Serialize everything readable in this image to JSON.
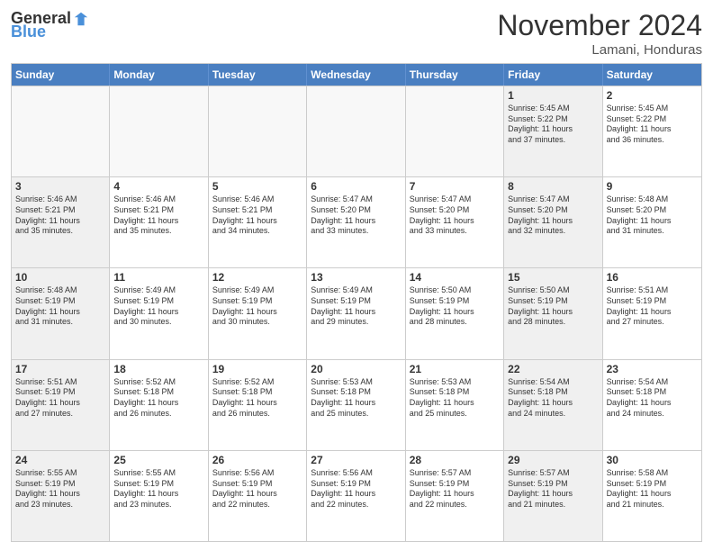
{
  "header": {
    "logo_general": "General",
    "logo_blue": "Blue",
    "month_title": "November 2024",
    "location": "Lamani, Honduras"
  },
  "weekdays": [
    "Sunday",
    "Monday",
    "Tuesday",
    "Wednesday",
    "Thursday",
    "Friday",
    "Saturday"
  ],
  "rows": [
    [
      {
        "num": "",
        "info": "",
        "empty": true
      },
      {
        "num": "",
        "info": "",
        "empty": true
      },
      {
        "num": "",
        "info": "",
        "empty": true
      },
      {
        "num": "",
        "info": "",
        "empty": true
      },
      {
        "num": "",
        "info": "",
        "empty": true
      },
      {
        "num": "1",
        "info": "Sunrise: 5:45 AM\nSunset: 5:22 PM\nDaylight: 11 hours\nand 37 minutes.",
        "shaded": true
      },
      {
        "num": "2",
        "info": "Sunrise: 5:45 AM\nSunset: 5:22 PM\nDaylight: 11 hours\nand 36 minutes.",
        "shaded": false
      }
    ],
    [
      {
        "num": "3",
        "info": "Sunrise: 5:46 AM\nSunset: 5:21 PM\nDaylight: 11 hours\nand 35 minutes.",
        "shaded": true
      },
      {
        "num": "4",
        "info": "Sunrise: 5:46 AM\nSunset: 5:21 PM\nDaylight: 11 hours\nand 35 minutes.",
        "shaded": false
      },
      {
        "num": "5",
        "info": "Sunrise: 5:46 AM\nSunset: 5:21 PM\nDaylight: 11 hours\nand 34 minutes.",
        "shaded": false
      },
      {
        "num": "6",
        "info": "Sunrise: 5:47 AM\nSunset: 5:20 PM\nDaylight: 11 hours\nand 33 minutes.",
        "shaded": false
      },
      {
        "num": "7",
        "info": "Sunrise: 5:47 AM\nSunset: 5:20 PM\nDaylight: 11 hours\nand 33 minutes.",
        "shaded": false
      },
      {
        "num": "8",
        "info": "Sunrise: 5:47 AM\nSunset: 5:20 PM\nDaylight: 11 hours\nand 32 minutes.",
        "shaded": true
      },
      {
        "num": "9",
        "info": "Sunrise: 5:48 AM\nSunset: 5:20 PM\nDaylight: 11 hours\nand 31 minutes.",
        "shaded": false
      }
    ],
    [
      {
        "num": "10",
        "info": "Sunrise: 5:48 AM\nSunset: 5:19 PM\nDaylight: 11 hours\nand 31 minutes.",
        "shaded": true
      },
      {
        "num": "11",
        "info": "Sunrise: 5:49 AM\nSunset: 5:19 PM\nDaylight: 11 hours\nand 30 minutes.",
        "shaded": false
      },
      {
        "num": "12",
        "info": "Sunrise: 5:49 AM\nSunset: 5:19 PM\nDaylight: 11 hours\nand 30 minutes.",
        "shaded": false
      },
      {
        "num": "13",
        "info": "Sunrise: 5:49 AM\nSunset: 5:19 PM\nDaylight: 11 hours\nand 29 minutes.",
        "shaded": false
      },
      {
        "num": "14",
        "info": "Sunrise: 5:50 AM\nSunset: 5:19 PM\nDaylight: 11 hours\nand 28 minutes.",
        "shaded": false
      },
      {
        "num": "15",
        "info": "Sunrise: 5:50 AM\nSunset: 5:19 PM\nDaylight: 11 hours\nand 28 minutes.",
        "shaded": true
      },
      {
        "num": "16",
        "info": "Sunrise: 5:51 AM\nSunset: 5:19 PM\nDaylight: 11 hours\nand 27 minutes.",
        "shaded": false
      }
    ],
    [
      {
        "num": "17",
        "info": "Sunrise: 5:51 AM\nSunset: 5:19 PM\nDaylight: 11 hours\nand 27 minutes.",
        "shaded": true
      },
      {
        "num": "18",
        "info": "Sunrise: 5:52 AM\nSunset: 5:18 PM\nDaylight: 11 hours\nand 26 minutes.",
        "shaded": false
      },
      {
        "num": "19",
        "info": "Sunrise: 5:52 AM\nSunset: 5:18 PM\nDaylight: 11 hours\nand 26 minutes.",
        "shaded": false
      },
      {
        "num": "20",
        "info": "Sunrise: 5:53 AM\nSunset: 5:18 PM\nDaylight: 11 hours\nand 25 minutes.",
        "shaded": false
      },
      {
        "num": "21",
        "info": "Sunrise: 5:53 AM\nSunset: 5:18 PM\nDaylight: 11 hours\nand 25 minutes.",
        "shaded": false
      },
      {
        "num": "22",
        "info": "Sunrise: 5:54 AM\nSunset: 5:18 PM\nDaylight: 11 hours\nand 24 minutes.",
        "shaded": true
      },
      {
        "num": "23",
        "info": "Sunrise: 5:54 AM\nSunset: 5:18 PM\nDaylight: 11 hours\nand 24 minutes.",
        "shaded": false
      }
    ],
    [
      {
        "num": "24",
        "info": "Sunrise: 5:55 AM\nSunset: 5:19 PM\nDaylight: 11 hours\nand 23 minutes.",
        "shaded": true
      },
      {
        "num": "25",
        "info": "Sunrise: 5:55 AM\nSunset: 5:19 PM\nDaylight: 11 hours\nand 23 minutes.",
        "shaded": false
      },
      {
        "num": "26",
        "info": "Sunrise: 5:56 AM\nSunset: 5:19 PM\nDaylight: 11 hours\nand 22 minutes.",
        "shaded": false
      },
      {
        "num": "27",
        "info": "Sunrise: 5:56 AM\nSunset: 5:19 PM\nDaylight: 11 hours\nand 22 minutes.",
        "shaded": false
      },
      {
        "num": "28",
        "info": "Sunrise: 5:57 AM\nSunset: 5:19 PM\nDaylight: 11 hours\nand 22 minutes.",
        "shaded": false
      },
      {
        "num": "29",
        "info": "Sunrise: 5:57 AM\nSunset: 5:19 PM\nDaylight: 11 hours\nand 21 minutes.",
        "shaded": true
      },
      {
        "num": "30",
        "info": "Sunrise: 5:58 AM\nSunset: 5:19 PM\nDaylight: 11 hours\nand 21 minutes.",
        "shaded": false
      }
    ]
  ]
}
